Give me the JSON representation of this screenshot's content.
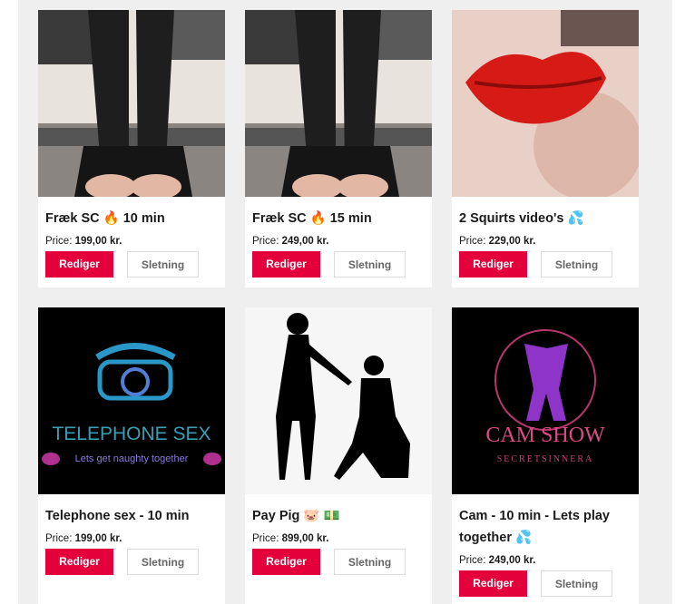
{
  "price_prefix": "Price:",
  "edit_label": "Rediger",
  "delete_label": "Sletning",
  "products": [
    {
      "title": "Fræk SC 🔥 10 min",
      "price": "199,00 kr."
    },
    {
      "title": "Fræk SC 🔥 15 min",
      "price": "249,00 kr."
    },
    {
      "title": "2 Squirts video's 💦",
      "price": "229,00 kr."
    },
    {
      "title": "Telephone sex - 10 min",
      "price": "199,00 kr."
    },
    {
      "title": "Pay Pig 🐷 💵",
      "price": "899,00 kr."
    },
    {
      "title": "Cam - 10 min - Lets play together 💦",
      "price": "249,00 kr."
    }
  ],
  "images": {
    "telephone_line1": "TELEPHONE SEX",
    "telephone_line2": "Lets get naughty together",
    "cam_line1": "CAM SHOW",
    "cam_line2": "SECRETSINNERA"
  }
}
